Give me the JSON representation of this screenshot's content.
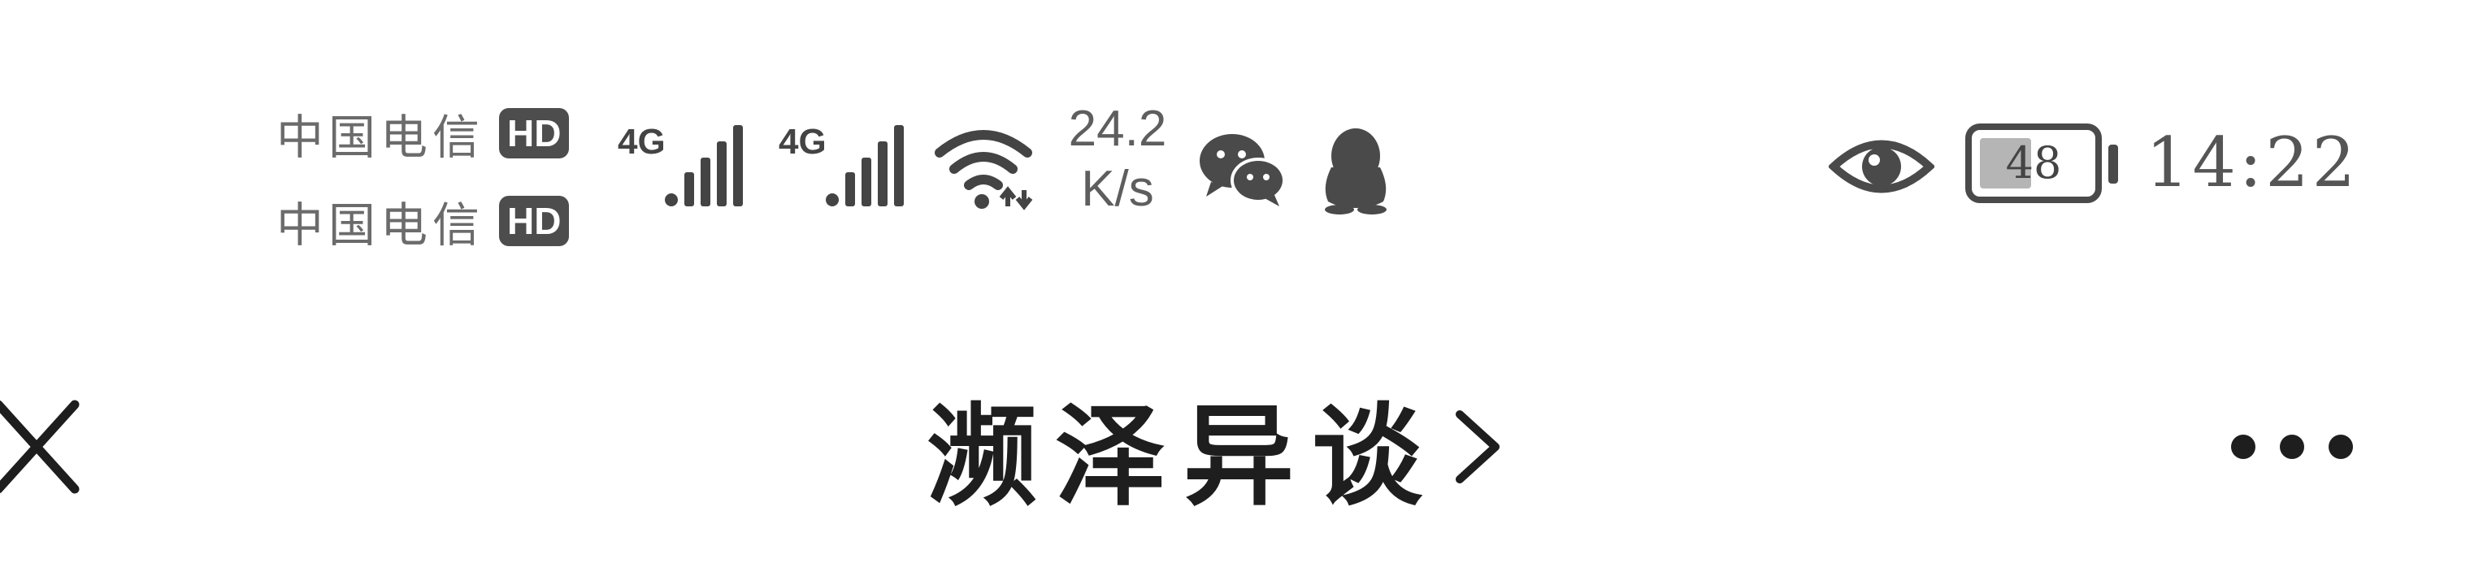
{
  "status_bar": {
    "carriers": [
      {
        "name": "中国电信",
        "badge": "HD"
      },
      {
        "name": "中国电信",
        "badge": "HD"
      }
    ],
    "networks": [
      {
        "type": "4G",
        "icon": "signal-bars-icon"
      },
      {
        "type": "4G",
        "icon": "signal-bars-icon"
      }
    ],
    "wifi_icon": "wifi-icon",
    "speed": {
      "value": "24.2",
      "unit": "K/s"
    },
    "notification_icons": [
      "wechat-icon",
      "qq-icon"
    ],
    "eye_icon": "eye-icon",
    "battery": {
      "level": "48",
      "fraction": 0.48
    },
    "time": "14:22"
  },
  "title_bar": {
    "close_icon": "close-icon",
    "title": "濒泽异谈",
    "chevron_icon": "chevron-right-icon",
    "more_icon": "more-icon"
  },
  "colors": {
    "background": "#ffffff",
    "icon_gray": "#4a4a4a",
    "title_text": "#1e1e1e"
  }
}
